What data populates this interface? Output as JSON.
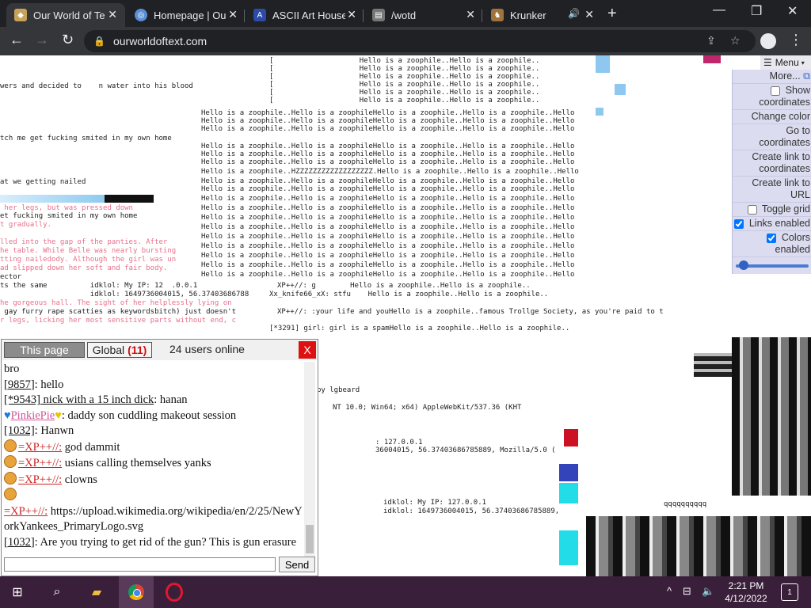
{
  "browser": {
    "tabs": [
      {
        "title": "Our World of Te",
        "active": true,
        "favicon_color": "#c9a25a"
      },
      {
        "title": "Homepage | Ou",
        "active": false,
        "favicon_color": "#5a8ed6"
      },
      {
        "title": "ASCII Art House",
        "active": false,
        "favicon_color": "#2c4aa8"
      },
      {
        "title": "/wotd",
        "active": false,
        "favicon_color": "#888888"
      },
      {
        "title": "Krunker",
        "active": false,
        "favicon_color": "#a0723c"
      }
    ],
    "url": "ourworldoftext.com"
  },
  "world": {
    "lines": [
      {
        "text": "[                    Hello is a zoophile..Hello is a zoophile..",
        "style": "dark"
      },
      {
        "text": "wers and decided to    n water into his blood",
        "style": "dark"
      },
      {
        "text": "tch me get fucking smited in my own home",
        "style": "dark"
      },
      {
        "text": "at we getting nailed",
        "style": "dark"
      },
      {
        "text": " her legs, but was pressed down",
        "style": "pink"
      },
      {
        "text": "et fucking smited in my own home",
        "style": "dark"
      },
      {
        "text": "t gradually.",
        "style": "pink"
      },
      {
        "text": "lled into the gap of the panties. After ",
        "style": "pink"
      },
      {
        "text": "he table. While Belle was nearly bursting",
        "style": "pink"
      },
      {
        "text": "tting nailedody. Although the girl was un",
        "style": "pink"
      },
      {
        "text": "ad slipped down her soft and fair body.",
        "style": "pink"
      },
      {
        "text": "ector",
        "style": "dark"
      },
      {
        "text": "ts the same          idklol: My IP: 12  .0.0.1",
        "style": "dark"
      },
      {
        "text": "                     idklol: 1649736004015, 56.37403686788",
        "style": "dark"
      },
      {
        "text": "he gorgeous hall. The sight of her helplessly lying on ",
        "style": "pink"
      },
      {
        "text": " gay furry rape scatties as keywordsbitch) just doesn't ",
        "style": "dark"
      },
      {
        "text": "r legs, licking her most sensitive parts without end, c",
        "style": "pink"
      },
      {
        "text": "Hello is a zoophile..Hello is a zoophileHello is a zoophile..Hello is a zoophile..Hello",
        "style": "dark"
      },
      {
        "text": "Hello is a zoophile..HZZZZZZZZZZZZZZZZZZ.Hello is a zoophile..Hello is a zoophile..Hello",
        "style": "dark"
      },
      {
        "text": "XP++//: g        Hello is a zoophile..Hello is a zoophile..",
        "style": "dark"
      },
      {
        "text": "Xx_knife66_xX: stfu    Hello is a zoophile..Hello is a zoophile..",
        "style": "dark"
      },
      {
        "text": "XP++//: :your life and youHello is a zoophile..famous Trollge Society, as you're paid to t",
        "style": "dark"
      },
      {
        "text": "[*3291] girl: girl is a spamHello is a zoophile..Hello is a zoophile..",
        "style": "dark"
      },
      {
        "text": "NT 10.0; Win64; x64) AppleWebKit/537.36 (KHT",
        "style": "dark"
      },
      {
        "text": ": 127.0.0.1",
        "style": "dark"
      },
      {
        "text": "36004015, 56.37403686785889, Mozilla/5.0 (",
        "style": "dark"
      },
      {
        "text": "idklol: My IP: 127.0.0.1",
        "style": "dark"
      },
      {
        "text": "idklol: 1649736004015, 56.37403686785889,",
        "style": "dark"
      },
      {
        "text": "by lgbeard",
        "style": "dark"
      },
      {
        "text": "qqqqqqqqqq",
        "style": "dark"
      }
    ]
  },
  "menu": {
    "button_label": "Menu",
    "items": [
      {
        "label": "More...",
        "type": "link"
      },
      {
        "label": "Show coordinates",
        "type": "checkbox",
        "checked": false
      },
      {
        "label": "Change color",
        "type": "link"
      },
      {
        "label": "Go to coordinates",
        "type": "link"
      },
      {
        "label": "Create link to coordinates",
        "type": "link"
      },
      {
        "label": "Create link to URL",
        "type": "link"
      },
      {
        "label": "Toggle grid",
        "type": "checkbox",
        "checked": false
      },
      {
        "label": "Links enabled",
        "type": "checkbox",
        "checked": true
      },
      {
        "label": "Colors enabled",
        "type": "checkbox",
        "checked": true
      }
    ],
    "zoom_fraction": 0.05
  },
  "chat": {
    "tab_this": "This page",
    "tab_global": "Global",
    "global_count": "(11)",
    "online": "24 users online",
    "close": "X",
    "send": "Send",
    "messages": [
      {
        "id": "",
        "name": "",
        "text": "bro",
        "name_style": "none",
        "emoji": ""
      },
      {
        "id": "[9857]",
        "name": "",
        "text": ": hello",
        "name_style": "none",
        "emoji": ""
      },
      {
        "id": "[*9543]",
        "name": " nick with a 15 inch dick",
        "text": ": hanan",
        "name_style": "dark",
        "emoji": ""
      },
      {
        "id": "",
        "name": "PinkiePie",
        "text": ": daddy son cuddling makeout session",
        "name_style": "pink",
        "emoji": "hearts"
      },
      {
        "id": "[1032]",
        "name": "",
        "text": ": Hanwn",
        "name_style": "none",
        "emoji": ""
      },
      {
        "id": "",
        "name": "=XP++//:",
        "text": " god dammit",
        "name_style": "red",
        "emoji": "cookie"
      },
      {
        "id": "",
        "name": "=XP++//:",
        "text": " usians calling themselves yanks",
        "name_style": "red",
        "emoji": "cookie"
      },
      {
        "id": "",
        "name": "=XP++//:",
        "text": " clowns",
        "name_style": "red",
        "emoji": "cookie"
      },
      {
        "id": "",
        "name": "",
        "text": "",
        "name_style": "none",
        "emoji": "cookie"
      },
      {
        "id": "",
        "name": "=XP++//:",
        "text": " https://upload.wikimedia.org/wikipedia/en/2/25/NewYorkYankees_PrimaryLogo.svg",
        "name_style": "red",
        "emoji": ""
      },
      {
        "id": "[1032]",
        "name": "",
        "text": ": Are you trying to get rid of the gun? This is gun erasure",
        "name_style": "none",
        "emoji": ""
      }
    ]
  },
  "taskbar": {
    "time": "2:21 PM",
    "date": "4/12/2022",
    "notifications": "1"
  }
}
